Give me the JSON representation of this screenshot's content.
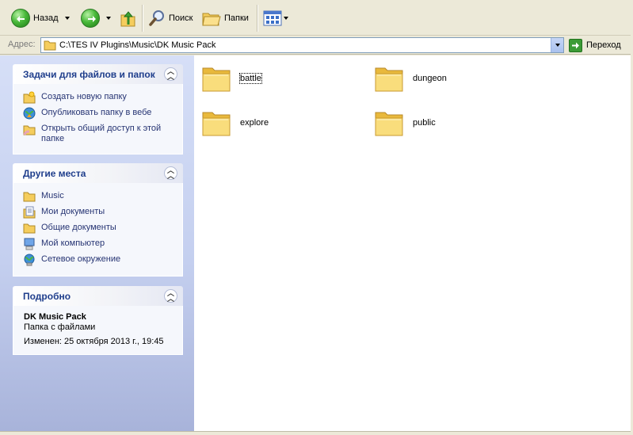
{
  "toolbar": {
    "back_label": "Назад",
    "search_label": "Поиск",
    "folders_label": "Папки"
  },
  "address": {
    "label": "Адрес:",
    "path": "C:\\TES IV Plugins\\Music\\DK Music Pack",
    "go_label": "Переход"
  },
  "tasks_panel": {
    "title": "Задачи для файлов и папок",
    "items": [
      {
        "label": "Создать новую папку",
        "icon": "new-folder-icon"
      },
      {
        "label": "Опубликовать папку в вебе",
        "icon": "publish-web-icon"
      },
      {
        "label": "Открыть общий доступ к этой папке",
        "icon": "share-folder-icon"
      }
    ]
  },
  "places_panel": {
    "title": "Другие места",
    "items": [
      {
        "label": "Music",
        "icon": "folder-icon"
      },
      {
        "label": "Мои документы",
        "icon": "my-documents-icon"
      },
      {
        "label": "Общие документы",
        "icon": "shared-documents-icon"
      },
      {
        "label": "Мой компьютер",
        "icon": "my-computer-icon"
      },
      {
        "label": "Сетевое окружение",
        "icon": "network-places-icon"
      }
    ]
  },
  "details_panel": {
    "title": "Подробно",
    "name": "DK Music Pack",
    "type": "Папка с файлами",
    "modified": "Изменен: 25 октября 2013 г., 19:45"
  },
  "folders": [
    {
      "name": "battle"
    },
    {
      "name": "dungeon"
    },
    {
      "name": "explore"
    },
    {
      "name": "public"
    }
  ],
  "colors": {
    "pane_top": "#d6dff7",
    "pane_bottom": "#a8b3da",
    "header_text": "#1f3e8c",
    "link_text": "#263473",
    "folder_yellow": "#f7d56b"
  }
}
